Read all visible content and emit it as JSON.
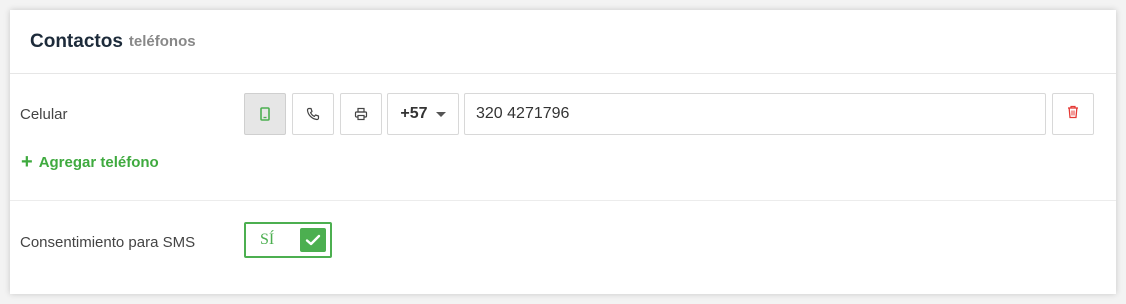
{
  "header": {
    "title": "Contactos",
    "subtitle": "teléfonos"
  },
  "phone": {
    "label": "Celular",
    "types": [
      {
        "icon": "mobile-phone-icon",
        "active": true
      },
      {
        "icon": "phone-handset-icon",
        "active": false
      },
      {
        "icon": "fax-printer-icon",
        "active": false
      }
    ],
    "country_code": "+57",
    "number": "320 4271796",
    "delete_icon": "trash-icon",
    "add_label": "Agregar teléfono"
  },
  "sms": {
    "label": "Consentimiento para SMS",
    "value": "SÍ",
    "checked": true
  },
  "colors": {
    "accent": "#4caf50",
    "add_link": "#3faa3f",
    "delete": "#e53935",
    "title": "#1d2b3a",
    "subtitle": "#888888"
  }
}
